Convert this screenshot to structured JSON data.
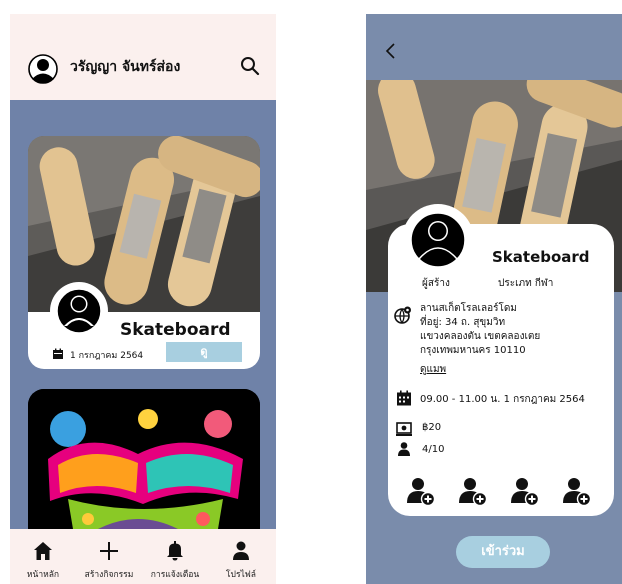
{
  "list_screen": {
    "header": {
      "username": "วรัญญา จันทร์ส่อง"
    },
    "events": [
      {
        "title": "Skateboard",
        "date": "1 กรกฎาคม 2564",
        "view_label": "ดู"
      }
    ],
    "nav": [
      {
        "icon": "home-icon",
        "label": "หน้าหลัก"
      },
      {
        "icon": "plus-icon",
        "label": "สร้างกิจกรรม"
      },
      {
        "icon": "bell-icon",
        "label": "การแจ้งเตือน"
      },
      {
        "icon": "person-icon",
        "label": "โปรไฟล์"
      }
    ]
  },
  "detail_screen": {
    "title": "Skateboard",
    "creator_label": "ผู้สร้าง",
    "type_label": "ประเภท กีฬา",
    "address": [
      "ลานสเก็ตโรลเลอร์โดม",
      "ที่อยู่: 34 ถ. สุขุมวิท",
      "แขวงคลองตัน เขตคลองเตย",
      "กรุงเทพมหานคร 10110"
    ],
    "map_link": "ดูแมพ",
    "time": "09.00 - 11.00 น. 1 กรกฎาคม 2564",
    "price": "฿20",
    "participants": "4/10",
    "join_label": "เข้าร่วม"
  },
  "colors": {
    "background": "#6f82a8",
    "header": "#fbf0ee",
    "accent": "#a8cfe0",
    "card": "#ffffff"
  }
}
